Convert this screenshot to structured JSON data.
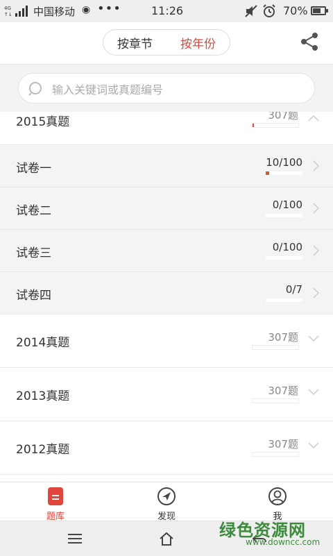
{
  "status_bar": {
    "network": "4G",
    "carrier": "中国移动",
    "dots": "•••",
    "time": "11:26",
    "battery": "70%",
    "battery_level": 0.7
  },
  "header": {
    "seg_options": [
      "按章节",
      "按年份"
    ],
    "active_index": 1
  },
  "search": {
    "placeholder": "输入关键词或真题编号"
  },
  "years": [
    {
      "title": "2015真题",
      "count": "307题",
      "progress": 0.01,
      "expanded": true
    },
    {
      "title": "2014真题",
      "count": "307题",
      "progress": 0,
      "expanded": false
    },
    {
      "title": "2013真题",
      "count": "307题",
      "progress": 0,
      "expanded": false
    },
    {
      "title": "2012真题",
      "count": "307题",
      "progress": 0,
      "expanded": false
    }
  ],
  "papers": [
    {
      "title": "试卷一",
      "value": "10/100",
      "progress": 0.1
    },
    {
      "title": "试卷二",
      "value": "0/100",
      "progress": 0
    },
    {
      "title": "试卷三",
      "value": "0/100",
      "progress": 0
    },
    {
      "title": "试卷四",
      "value": "0/7",
      "progress": 0
    }
  ],
  "tabs": [
    {
      "label": "题库",
      "icon": "question-bank-icon",
      "active": true
    },
    {
      "label": "发现",
      "icon": "compass-icon",
      "active": false
    },
    {
      "label": "我",
      "icon": "user-icon",
      "active": false
    }
  ],
  "watermark": {
    "name": "绿色资源网",
    "url": "www.downcc.com"
  },
  "colors": {
    "accent": "#e0463c",
    "progress": "#d9562a"
  }
}
